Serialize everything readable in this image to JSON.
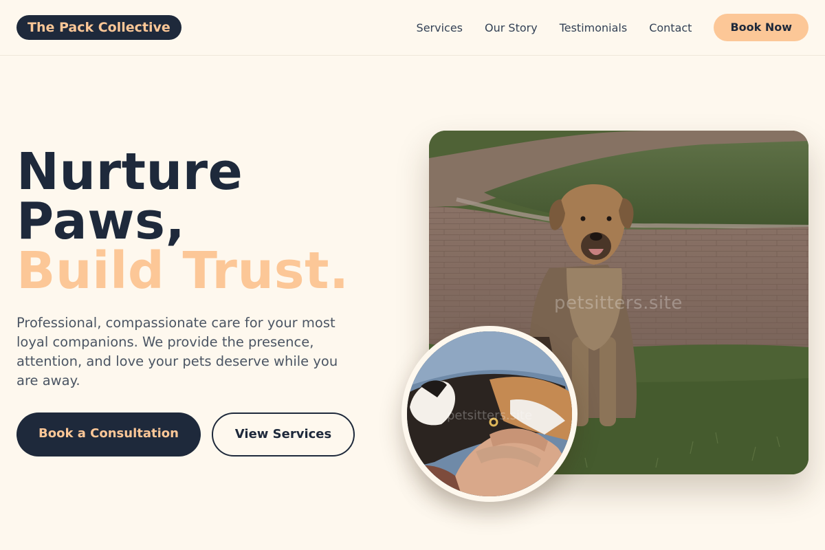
{
  "brand": {
    "name": "The Pack Collective"
  },
  "nav": {
    "links": [
      "Services",
      "Our Story",
      "Testimonials",
      "Contact"
    ],
    "cta": "Book Now"
  },
  "hero": {
    "title_lines": [
      "Nurture",
      "Paws,",
      "Build Trust."
    ],
    "description": "Professional, compassionate care for your most loyal companions. We provide the presence, attention, and love your pets deserve while you are away.",
    "primary_button": "Book a Consultation",
    "secondary_button": "View Services"
  },
  "images": {
    "main_watermark": "petsitters.site",
    "inset_watermark": "petsitters.site"
  },
  "colors": {
    "background": "#fef8ee",
    "navy": "#1e293b",
    "peach": "#fcc797",
    "body_text": "#4b5563"
  }
}
